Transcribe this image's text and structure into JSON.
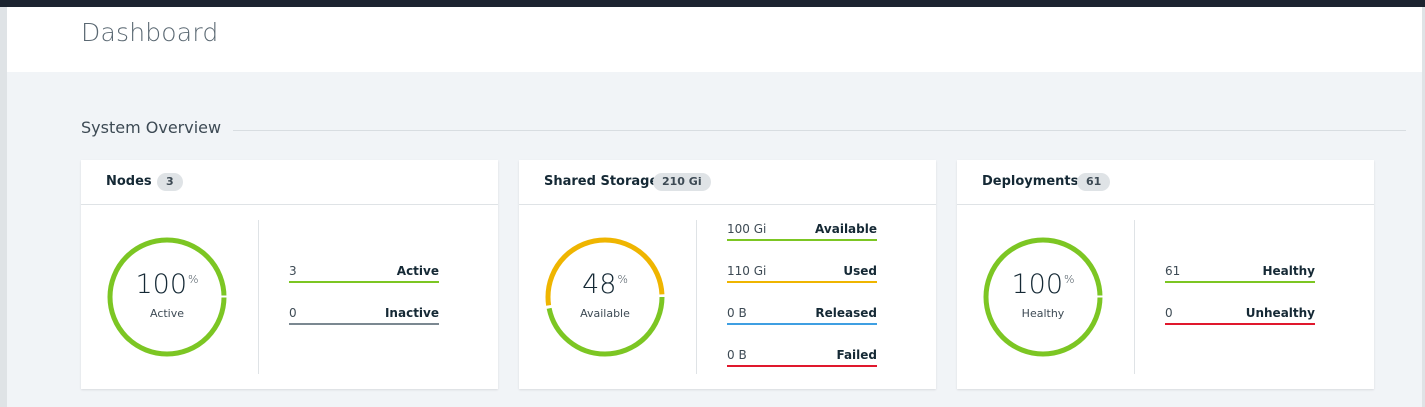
{
  "page": {
    "title": "Dashboard"
  },
  "section": {
    "title": "System Overview"
  },
  "colors": {
    "green": "#7cc623",
    "yellow": "#efb500",
    "blue": "#3f9fe2",
    "red": "#e0182d",
    "gray": "#7b8891"
  },
  "cards": [
    {
      "title": "Nodes",
      "badge": "3",
      "donut": {
        "percent": "100",
        "unit": "%",
        "label": "Active",
        "segments": [
          {
            "color": "#7cc623",
            "fraction": 1.0
          }
        ]
      },
      "legend": [
        {
          "value": "3",
          "label": "Active",
          "color": "#7cc623"
        },
        {
          "value": "0",
          "label": "Inactive",
          "color": "#7b8891"
        }
      ]
    },
    {
      "title": "Shared Storage",
      "badge": "210 Gi",
      "donut": {
        "percent": "48",
        "unit": "%",
        "label": "Available",
        "segments": [
          {
            "color": "#7cc623",
            "fraction": 0.476
          },
          {
            "color": "#efb500",
            "fraction": 0.524
          }
        ]
      },
      "legend": [
        {
          "value": "100 Gi",
          "label": "Available",
          "color": "#7cc623"
        },
        {
          "value": "110 Gi",
          "label": "Used",
          "color": "#efb500"
        },
        {
          "value": "0 B",
          "label": "Released",
          "color": "#3f9fe2"
        },
        {
          "value": "0 B",
          "label": "Failed",
          "color": "#e0182d"
        }
      ]
    },
    {
      "title": "Deployments",
      "badge": "61",
      "donut": {
        "percent": "100",
        "unit": "%",
        "label": "Healthy",
        "segments": [
          {
            "color": "#7cc623",
            "fraction": 1.0
          }
        ]
      },
      "legend": [
        {
          "value": "61",
          "label": "Healthy",
          "color": "#7cc623"
        },
        {
          "value": "0",
          "label": "Unhealthy",
          "color": "#e0182d"
        }
      ]
    }
  ]
}
